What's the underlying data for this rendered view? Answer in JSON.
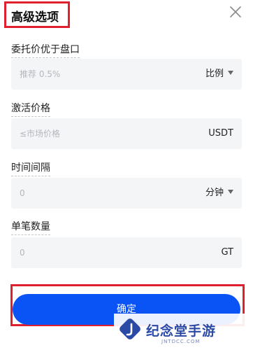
{
  "header": {
    "title": "高级选项",
    "close_icon": "close-icon"
  },
  "fields": [
    {
      "label": "委托价优于盘口",
      "placeholder": "推荐 0.5%",
      "unit": "比例",
      "has_dropdown": true
    },
    {
      "label": "激活价格",
      "placeholder": "≤市场价格",
      "unit": "USDT",
      "has_dropdown": false
    },
    {
      "label": "时间间隔",
      "placeholder": "0",
      "unit": "分钟",
      "has_dropdown": true
    },
    {
      "label": "单笔数量",
      "placeholder": "0",
      "unit": "GT",
      "has_dropdown": false
    }
  ],
  "footer": {
    "confirm_label": "确定"
  },
  "watermark": {
    "text": "纪念堂手游",
    "sub": "JNTDCC.COM"
  },
  "colors": {
    "accent": "#0a53f4",
    "highlight_box": "#e0202f",
    "field_bg": "#f4f5f7"
  }
}
